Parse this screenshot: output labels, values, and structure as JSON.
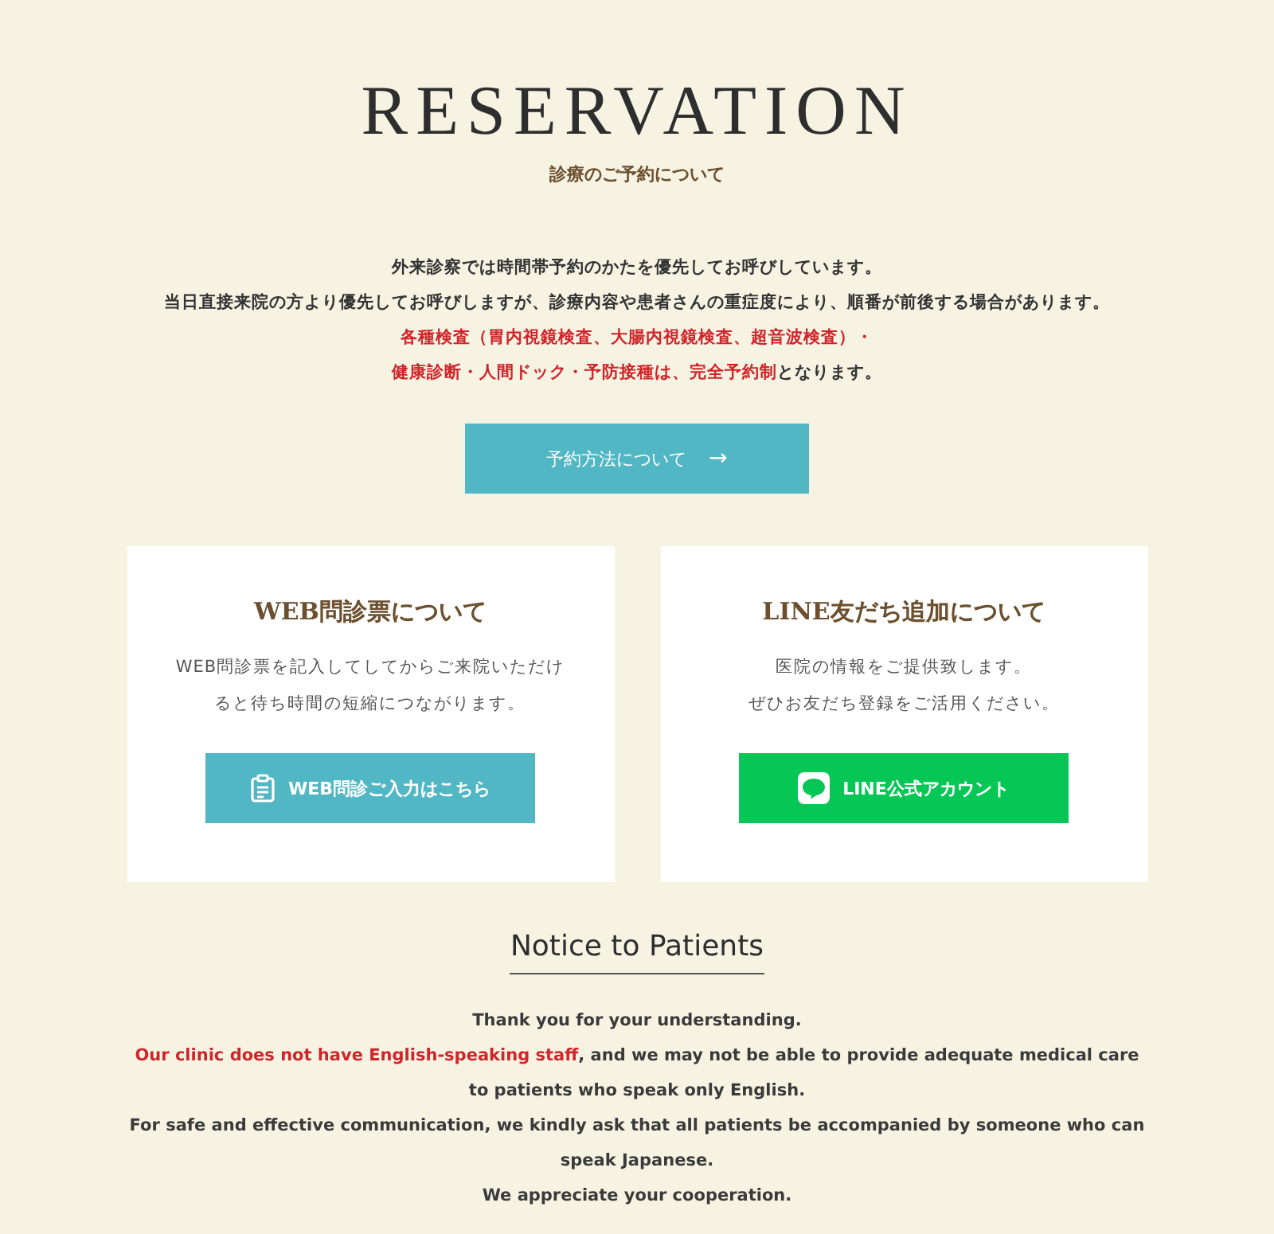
{
  "title": "RESERVATION",
  "subtitle": "診療のご予約について",
  "intro": [
    [
      {
        "text": "外来診察では時間帯予約のかたを優先してお呼びしています。",
        "emphasis": false
      }
    ],
    [
      {
        "text": "当日直接来院の方より優先してお呼びしますが、診療内容や患者さんの重症度により、順番が前後する場合があります。",
        "emphasis": false
      }
    ],
    [
      {
        "text": "各種検査（胃内視鏡検査、大腸内視鏡検査、超音波検査）・",
        "emphasis": true
      }
    ],
    [
      {
        "text": "健康診断・人間ドック・予防接種は、完全予約制",
        "emphasis": true
      },
      {
        "text": "となります。",
        "emphasis": false
      }
    ]
  ],
  "reserve_button": {
    "label": "予約方法について",
    "arrow": "→"
  },
  "cards": [
    {
      "title": "WEB問診票について",
      "lines": [
        "WEB問診票を記入してしてからご来院いただけ",
        "ると待ち時間の短縮につながります。"
      ],
      "button": "WEB問診ご入力はこちら",
      "kind": "web"
    },
    {
      "title": "LINE友だち追加について",
      "lines": [
        "医院の情報をご提供致します。",
        "ぜひお友だち登録をご活用ください。"
      ],
      "button": "LINE公式アカウント",
      "kind": "line"
    }
  ],
  "notice": {
    "title": "Notice to Patients",
    "paragraphs": [
      [
        {
          "text": "Thank you for your understanding.",
          "emphasis": false
        }
      ],
      [
        {
          "text": "Our clinic does not have English-speaking staff",
          "emphasis": true
        },
        {
          "text": ", and we may not be able to provide adequate medical care to patients who speak only English.",
          "emphasis": false
        }
      ],
      [
        {
          "text": "For safe and effective communication, we kindly ask that all patients be accompanied by someone who can speak Japanese.",
          "emphasis": false
        }
      ],
      [
        {
          "text": "We appreciate your cooperation.",
          "emphasis": false
        }
      ]
    ]
  }
}
